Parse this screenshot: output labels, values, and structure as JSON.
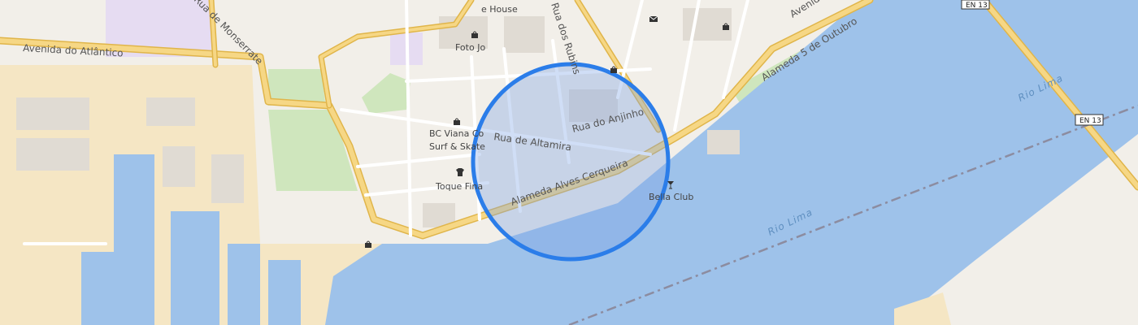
{
  "map": {
    "colors": {
      "land": "#f2efe9",
      "water": "#9ec2ea",
      "industrial": "#f5e6c4",
      "park": "#cfe6bd",
      "purple_area": "#e6dcf2",
      "building": "#e0dbd3",
      "major_road": "#f6d785",
      "major_road_casing": "#e0b54a",
      "minor_road": "#ffffff",
      "highlight_fill": "rgba(120,160,230,0.35)",
      "highlight_stroke": "#2b7de9"
    },
    "roads": {
      "avenida_atlantico": "Avenida do Atlântico",
      "monserrate": "Rua de Monserrate",
      "rubins": "Rua dos Rubins",
      "anjinho": "Rua do Anjinho",
      "altamira": "Rua de Altamira",
      "alves_cerqueira": "Alameda Alves Cerqueira",
      "alameda_5_outubro": "Alameda 5 de Outubro",
      "avenida": "Avenida"
    },
    "water_labels": {
      "rio_lima_1": "Rio Lima",
      "rio_lima_2": "Rio Lima"
    },
    "shields": {
      "en13_top": "EN 13",
      "en13_right": "EN 13"
    },
    "pois": {
      "house": "e House",
      "foto": "Foto Jo",
      "bc_line1": "BC Viana Co",
      "bc_line2": "Surf & Skate",
      "toque": "Toque Fina",
      "bella": "Bella Club"
    },
    "icons": {
      "shop": "shopping-bag-icon",
      "clothes": "tshirt-icon",
      "cocktail": "cocktail-icon",
      "mail": "mail-icon"
    }
  }
}
